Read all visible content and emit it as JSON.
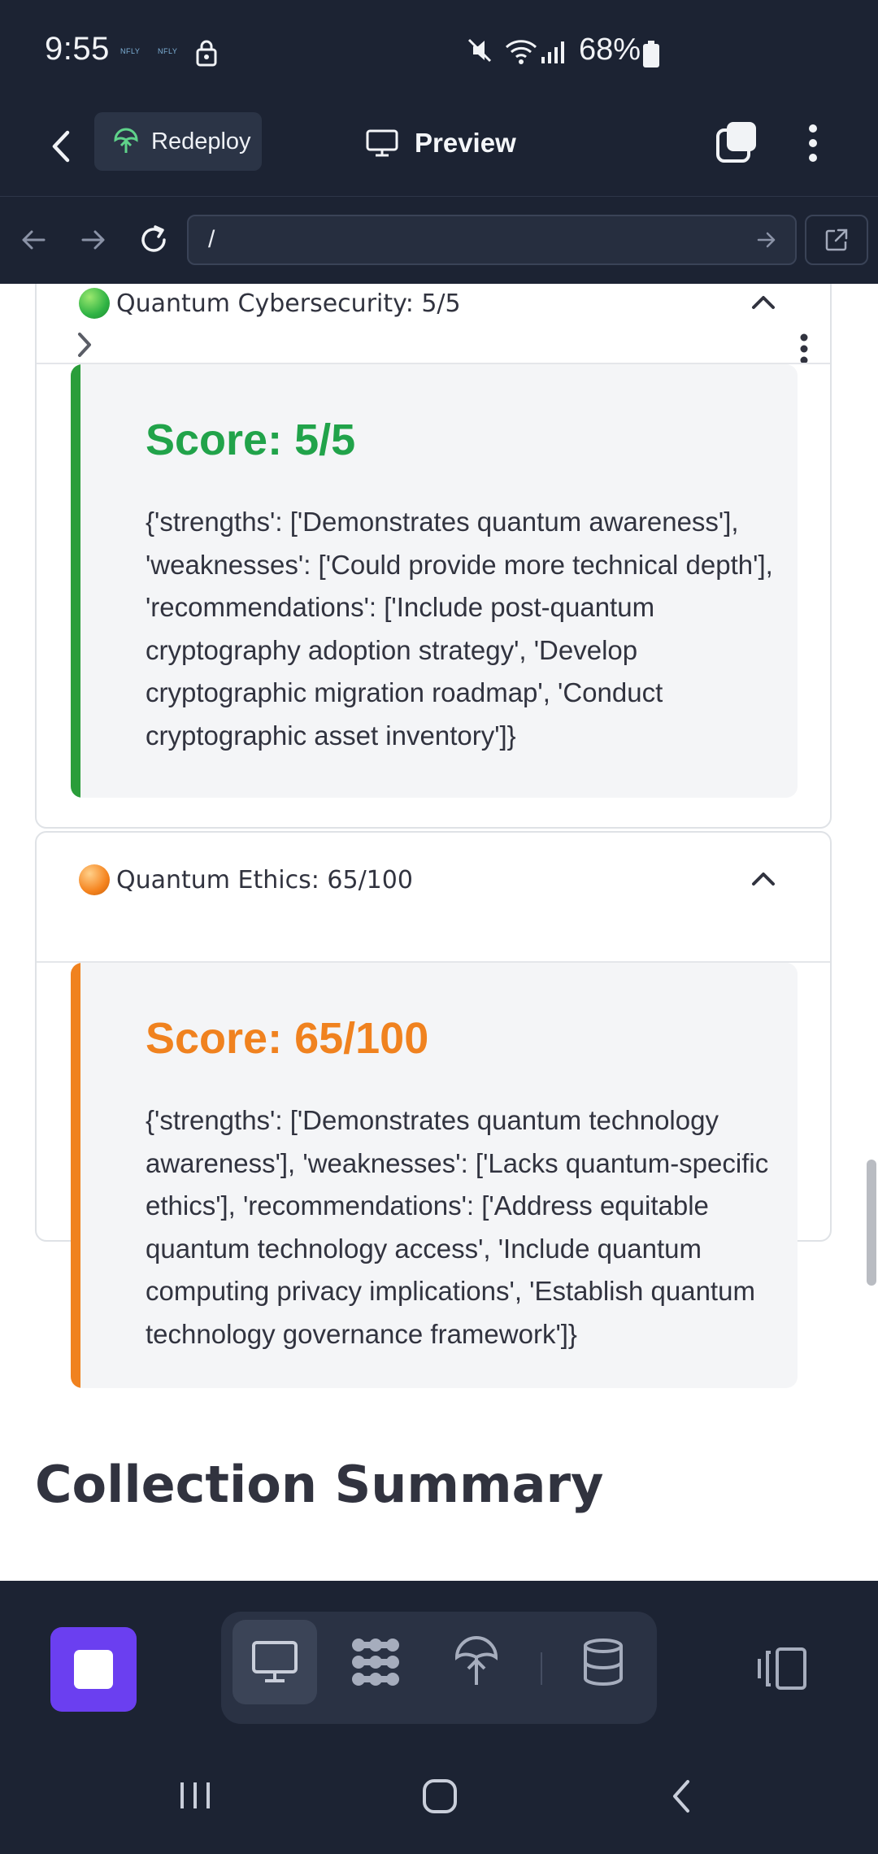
{
  "status_bar": {
    "time": "9:55",
    "notif1": "NFLY",
    "notif2": "NFLY",
    "battery_text": "68%"
  },
  "toolbar": {
    "redeploy_label": "Redeploy",
    "preview_label": "Preview"
  },
  "url_bar": {
    "path": "/"
  },
  "sections": [
    {
      "header": "Quantum Cybersecurity: 5/5",
      "dot_color": "#2fb344",
      "score": "Score: 5/5",
      "score_color": "#21a34a",
      "accent": "#2a9d3a",
      "body": "{'strengths': ['Demonstrates quantum awareness'], 'weaknesses': ['Could provide more technical depth'], 'recommendations': ['Include post-quantum cryptography adoption strategy', 'Develop cryptographic migration roadmap', 'Conduct cryptographic asset inventory']}"
    },
    {
      "header": "Quantum Ethics: 65/100",
      "dot_color": "#f5841f",
      "score": "Score: 65/100",
      "score_color": "#f0821f",
      "accent": "#f0821f",
      "body": "{'strengths': ['Demonstrates quantum technology awareness'], 'weaknesses': ['Lacks quantum-specific ethics'], 'recommendations': ['Address equitable quantum technology access', 'Include quantum computing privacy implications', 'Establish quantum technology governance framework']}"
    }
  ],
  "collection_summary_title": "Collection Summary",
  "bottom_tools": [
    "monitor-icon",
    "apps-grid-icon",
    "deploy-icon",
    "database-icon"
  ]
}
